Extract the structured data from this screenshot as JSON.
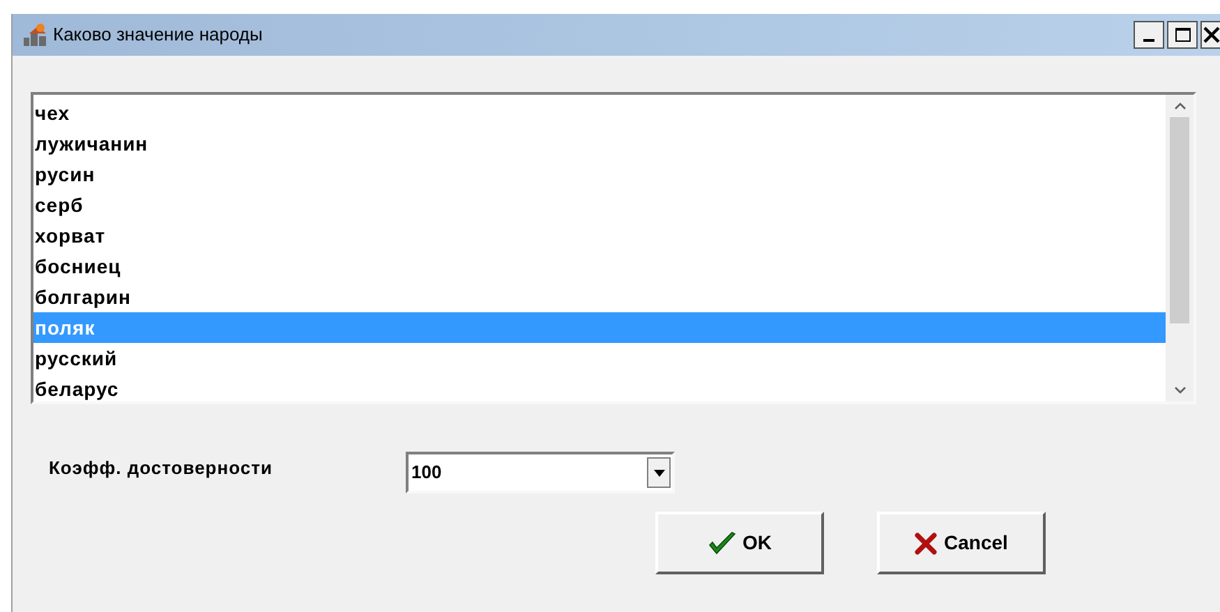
{
  "window": {
    "title": "Каково значение народы"
  },
  "list": {
    "items": [
      {
        "label": "чех",
        "selected": false
      },
      {
        "label": "лужичанин",
        "selected": false
      },
      {
        "label": "русин",
        "selected": false
      },
      {
        "label": "серб",
        "selected": false
      },
      {
        "label": "хорват",
        "selected": false
      },
      {
        "label": "босниец",
        "selected": false
      },
      {
        "label": "болгарин",
        "selected": false
      },
      {
        "label": "поляк",
        "selected": true
      },
      {
        "label": "русский",
        "selected": false
      },
      {
        "label": "беларус",
        "selected": false
      }
    ]
  },
  "reliability": {
    "label": "Коэфф. достоверности",
    "value": "100"
  },
  "buttons": [
    {
      "kind": "ok",
      "label": "OK"
    },
    {
      "kind": "cancel",
      "label": "Cancel"
    }
  ]
}
